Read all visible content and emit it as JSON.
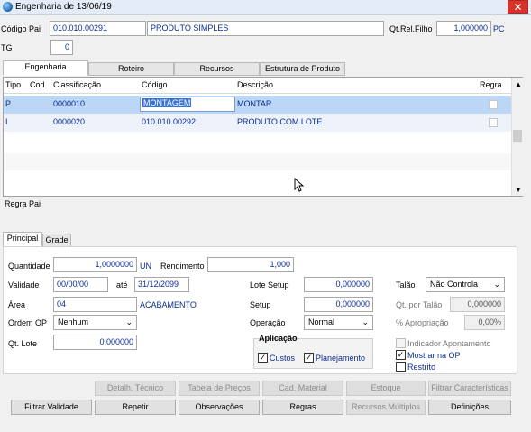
{
  "window": {
    "title": "Engenharia  de 13/06/19",
    "close_glyph": "✕"
  },
  "header": {
    "codigo_pai_label": "Código Pai",
    "codigo_pai_value": "010.010.00291",
    "produto_desc": "PRODUTO SIMPLES",
    "qt_rel_filho_label": "Qt.Rel.Filho",
    "qt_rel_filho_value": "1,000000",
    "qt_unit": "PC",
    "tg_label": "TG",
    "tg_value": "0"
  },
  "tabs": [
    "Engenharia",
    "Roteiro",
    "Recursos",
    "Estrutura  de  Produto"
  ],
  "grid": {
    "columns": [
      "Tipo",
      "Cod",
      "Classificação",
      "Código",
      "Descrição",
      "Regra"
    ],
    "rows": [
      {
        "tipo": "P",
        "cod": "",
        "classificacao": "0000010",
        "codigo": "MONTAGEM",
        "descricao": "MONTAR"
      },
      {
        "tipo": "I",
        "cod": "",
        "classificacao": "0000020",
        "codigo": "010.010.00292",
        "descricao": "PRODUTO COM LOTE"
      }
    ]
  },
  "regra_pai_label": "Regra Pai",
  "subtabs": [
    "Principal",
    "Grade"
  ],
  "form": {
    "quantidade_label": "Quantidade",
    "quantidade_value": "1,0000000",
    "quantidade_unit": "UN",
    "rendimento_label": "Rendimento",
    "rendimento_value": "1,000",
    "validade_label": "Validade",
    "validade_from": "00/00/00",
    "ate_label": "até",
    "validade_to": "31/12/2099",
    "area_label": "Área",
    "area_value": "04",
    "area_desc": "ACABAMENTO",
    "ordem_op_label": "Ordem OP",
    "ordem_op_value": "Nenhum",
    "qt_lote_label": "Qt. Lote",
    "qt_lote_value": "0,000000",
    "lote_setup_label": "Lote Setup",
    "lote_setup_value": "0,000000",
    "setup_label": "Setup",
    "setup_value": "0,000000",
    "operacao_label": "Operação",
    "operacao_value": "Normal",
    "talao_label": "Talão",
    "talao_value": "Não Controla",
    "qt_por_talao_label": "Qt. por Talão",
    "qt_por_talao_value": "0,000000",
    "apropriacao_label": "% Apropriação",
    "apropriacao_value": "0,00%",
    "aplicacao_label": "Aplicação",
    "custos_label": "Custos",
    "custos_checked": true,
    "planejamento_label": "Planejamento",
    "planejamento_checked": true,
    "indicador_label": "Indicador Apontamento",
    "indicador_checked": false,
    "mostrar_label": "Mostrar na OP",
    "mostrar_checked": true,
    "restrito_label": "Restrito",
    "restrito_checked": false,
    "check_glyph": "✓"
  },
  "buttons_row1": [
    "Detalh. Técnico",
    "Tabela de Preços",
    "Cad. Material",
    "Estoque",
    "Filtrar Características"
  ],
  "buttons_row2": [
    "Filtrar Validade",
    "Repetir",
    "Observações",
    "Regras",
    "Recursos Múltiplos",
    "Definições"
  ]
}
